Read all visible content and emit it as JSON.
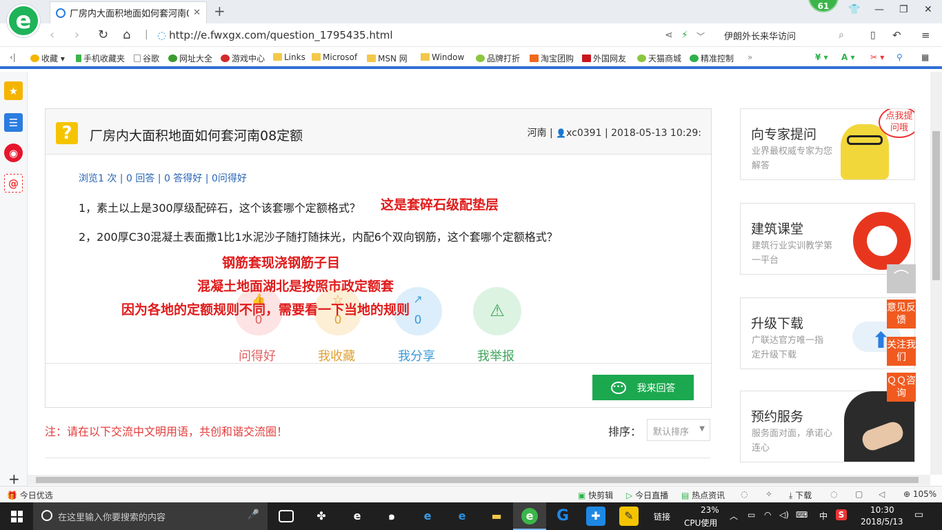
{
  "browser": {
    "tab_title": "厂房内大面积地面如何套河南08定",
    "badge_count": "61",
    "url": "http://e.fwxgx.com/question_1795435.html",
    "search_text": "伊朗外长来华访问",
    "bookmarks": [
      "收藏",
      "手机收藏夹",
      "谷歌",
      "网址大全",
      "游戏中心",
      "Links",
      "Microsof",
      "MSN 网",
      "Window",
      "品牌打折",
      "淘宝团购",
      "外国网友",
      "天猫商城",
      "精准控制"
    ],
    "icons": [
      "back-icon",
      "forward-icon",
      "refresh-icon",
      "home-icon",
      "share-icon",
      "lightning-icon",
      "search-icon",
      "phone-icon",
      "undo-icon",
      "menu-icon"
    ]
  },
  "question": {
    "title": "厂房内大面积地面如何套河南08定额",
    "meta": "河南 | ",
    "user": "xc0391",
    "date": " | 2018-05-13 10:29:",
    "stats": "浏览1 次 | 0 回答 | 0 答得好 | 0问得好",
    "para1": "1，素土以上是300厚级配碎石，这个该套哪个定额格式？",
    "para2": "2，200厚C30混凝土表面撒1比1水泥沙子随打随抹光，内配6个双向钢筋，这个套哪个定额格式？",
    "anno1": "这是套碎石级配垫层",
    "anno2": "钢筋套现浇钢筋子目",
    "anno3": "混凝土地面湖北是按照市政定额套",
    "anno4": "因为各地的定额规则不同，需要看一下当地的规则",
    "actions": [
      {
        "label": "问得好",
        "count": "0",
        "color": "#e06060",
        "bg": "#fde3e3"
      },
      {
        "label": "我收藏",
        "count": "0",
        "color": "#e0a030",
        "bg": "#fdefd6"
      },
      {
        "label": "我分享",
        "count": "0",
        "color": "#3a9ad8",
        "bg": "#dceefb"
      },
      {
        "label": "我举报",
        "count": "",
        "color": "#3ea55a",
        "bg": "#ddf3e2"
      }
    ],
    "answer_button": "我来回答"
  },
  "comments": {
    "notice": "注：请在以下交流中文明用语，共创和谐交流圈！",
    "sort_label": "排序：",
    "sort_value": "默认排序"
  },
  "sidebar": {
    "cards": [
      {
        "title": "向专家提问",
        "desc": "业界最权威专家为您解答",
        "bubble": "点我提问哦"
      },
      {
        "title": "建筑课堂",
        "desc": "建筑行业实训教学第一平台"
      },
      {
        "title": "升级下载",
        "desc": "广联达官方唯一指定升级下载"
      },
      {
        "title": "预约服务",
        "desc": "服务面对面，承诺心连心"
      }
    ],
    "float_buttons": [
      "意见反馈",
      "关注我们",
      "ＱＱ咨询"
    ]
  },
  "statusbar": {
    "left": "今日优选",
    "items": [
      "快剪辑",
      "今日直播",
      "热点资讯",
      "下载"
    ],
    "zoom": "105%"
  },
  "taskbar": {
    "search_placeholder": "在这里输入你要搜索的内容",
    "link_label": "链接",
    "cpu": "23%",
    "cpu_label": "CPU使用",
    "lang": "中",
    "time": "10:30",
    "date": "2018/5/13"
  }
}
